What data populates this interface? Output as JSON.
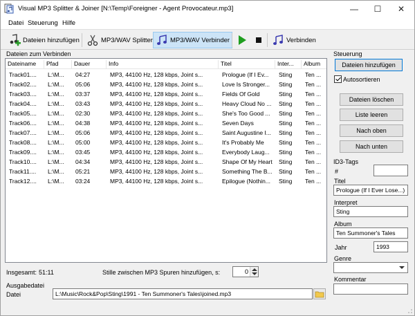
{
  "window": {
    "title": "Visual MP3 Splitter & Joiner [N:\\Temp\\Foreigner - Agent Provocateur.mp3]",
    "minimize_glyph": "—",
    "maximize_glyph": "☐",
    "close_glyph": "✕"
  },
  "menu": {
    "datei": "Datei",
    "steuerung": "Steuerung",
    "hilfe": "Hilfe"
  },
  "toolbar": {
    "add_files": "Dateien hinzufügen",
    "splitter": "MP3/WAV Splitter",
    "joiner": "MP3/WAV Verbinder",
    "play_icon": "play-icon",
    "stop_icon": "stop-icon",
    "join": "Verbinden"
  },
  "files_panel": {
    "label": "Dateien zum Verbinden",
    "columns": [
      "Dateiname",
      "Pfad",
      "Dauer",
      "Info",
      "Titel",
      "Inter...",
      "Album"
    ],
    "rows": [
      {
        "name": "Track01....",
        "path": "L:\\M...",
        "duration": "04:27",
        "info": "MP3, 44100 Hz, 128 kbps, Joint s...",
        "title": "Prologue (If I Ev...",
        "artist": "Sting",
        "album": "Ten ..."
      },
      {
        "name": "Track02....",
        "path": "L:\\M...",
        "duration": "05:06",
        "info": "MP3, 44100 Hz, 128 kbps, Joint s...",
        "title": "Love Is Stronger...",
        "artist": "Sting",
        "album": "Ten ..."
      },
      {
        "name": "Track03....",
        "path": "L:\\M...",
        "duration": "03:37",
        "info": "MP3, 44100 Hz, 128 kbps, Joint s...",
        "title": "Fields Of Gold",
        "artist": "Sting",
        "album": "Ten ..."
      },
      {
        "name": "Track04....",
        "path": "L:\\M...",
        "duration": "03:43",
        "info": "MP3, 44100 Hz, 128 kbps, Joint s...",
        "title": "Heavy Cloud No ...",
        "artist": "Sting",
        "album": "Ten ..."
      },
      {
        "name": "Track05....",
        "path": "L:\\M...",
        "duration": "02:30",
        "info": "MP3, 44100 Hz, 128 kbps, Joint s...",
        "title": "She's Too Good ...",
        "artist": "Sting",
        "album": "Ten ..."
      },
      {
        "name": "Track06....",
        "path": "L:\\M...",
        "duration": "04:38",
        "info": "MP3, 44100 Hz, 128 kbps, Joint s...",
        "title": "Seven Days",
        "artist": "Sting",
        "album": "Ten ..."
      },
      {
        "name": "Track07....",
        "path": "L:\\M...",
        "duration": "05:06",
        "info": "MP3, 44100 Hz, 128 kbps, Joint s...",
        "title": "Saint Augustine I...",
        "artist": "Sting",
        "album": "Ten ..."
      },
      {
        "name": "Track08....",
        "path": "L:\\M...",
        "duration": "05:00",
        "info": "MP3, 44100 Hz, 128 kbps, Joint s...",
        "title": "It's Probably Me",
        "artist": "Sting",
        "album": "Ten ..."
      },
      {
        "name": "Track09....",
        "path": "L:\\M...",
        "duration": "03:45",
        "info": "MP3, 44100 Hz, 128 kbps, Joint s...",
        "title": "Everybody Laug...",
        "artist": "Sting",
        "album": "Ten ..."
      },
      {
        "name": "Track10....",
        "path": "L:\\M...",
        "duration": "04:34",
        "info": "MP3, 44100 Hz, 128 kbps, Joint s...",
        "title": "Shape Of My Heart",
        "artist": "Sting",
        "album": "Ten ..."
      },
      {
        "name": "Track11....",
        "path": "L:\\M...",
        "duration": "05:21",
        "info": "MP3, 44100 Hz, 128 kbps, Joint s...",
        "title": "Something The B...",
        "artist": "Sting",
        "album": "Ten ..."
      },
      {
        "name": "Track12....",
        "path": "L:\\M...",
        "duration": "03:24",
        "info": "MP3, 44100 Hz, 128 kbps, Joint s...",
        "title": "Epilogue (Nothin...",
        "artist": "Sting",
        "album": "Ten ..."
      }
    ],
    "total_label": "Insgesamt:",
    "total_value": "51:11",
    "silence_label": "Stille zwischen MP3 Spuren hinzufügen, s:",
    "silence_value": "0"
  },
  "output": {
    "group_label": "Ausgabedatei",
    "file_label": "Datei",
    "file_value": "L:\\Music\\Rock&Pop\\Sting\\1991 - Ten Summoner's Tales\\joined.mp3"
  },
  "control": {
    "group_label": "Steuerung",
    "add_files": "Dateien hinzufügen",
    "autosort": "Autosortieren",
    "delete_files": "Dateien löschen",
    "clear_list": "Liste leeren",
    "move_up": "Nach oben",
    "move_down": "Nach unten"
  },
  "id3": {
    "group_label": "ID3-Tags",
    "number_label": "#",
    "number_value": "",
    "title_label": "Titel",
    "title_value": "Prologue (If I Ever Lose...)",
    "artist_label": "Interpret",
    "artist_value": "Sting",
    "album_label": "Album",
    "album_value": "Ten Summoner's Tales",
    "year_label": "Jahr",
    "year_value": "1993",
    "genre_label": "Genre",
    "genre_value": "",
    "comment_label": "Kommentar",
    "comment_value": ""
  }
}
